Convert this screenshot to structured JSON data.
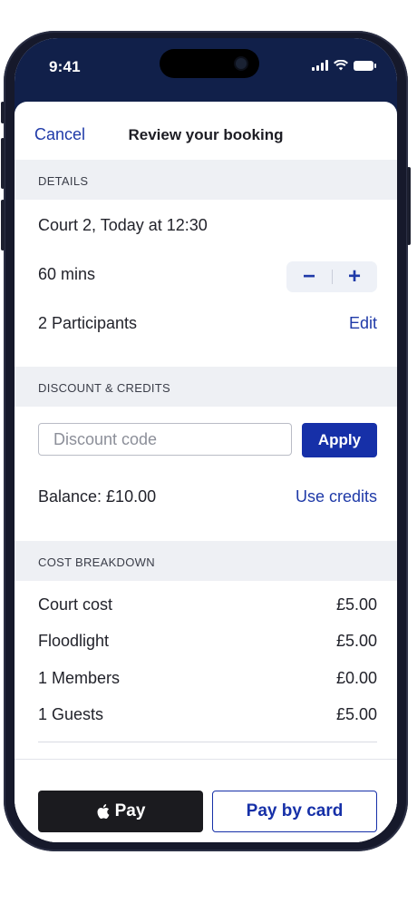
{
  "status_bar": {
    "time": "9:41",
    "icons": [
      "signal-icon",
      "wifi-icon",
      "battery-icon"
    ]
  },
  "nav": {
    "cancel_label": "Cancel",
    "title": "Review your booking"
  },
  "details": {
    "header": "DETAILS",
    "court": "Court 2, Today at 12:30",
    "duration": "60 mins",
    "stepper": {
      "minus": "−",
      "plus": "+"
    },
    "participants": "2 Participants",
    "edit_label": "Edit"
  },
  "discount": {
    "header": "DISCOUNT & CREDITS",
    "placeholder": "Discount code",
    "apply_label": "Apply",
    "balance": "Balance: £10.00",
    "use_credits_label": "Use credits"
  },
  "cost": {
    "header": "COST BREAKDOWN",
    "rows": [
      {
        "label": "Court cost",
        "value": "£5.00"
      },
      {
        "label": "Floodlight",
        "value": "£5.00"
      },
      {
        "label": "1 Members",
        "value": "£0.00"
      },
      {
        "label": "1 Guests",
        "value": "£5.00"
      }
    ]
  },
  "footer": {
    "apple_pay_label": "Pay",
    "card_pay_label": "Pay by card"
  },
  "colors": {
    "accent": "#1630a8",
    "status_bar": "#11204a",
    "section_bg": "#eef0f4"
  }
}
